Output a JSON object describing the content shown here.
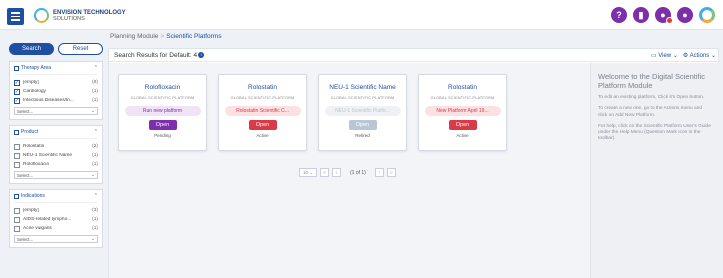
{
  "app": {
    "brand_name": "ENVISION TECHNOLOGY",
    "brand_sub": "SOLUTIONS"
  },
  "top_icons": [
    "help-circle-icon",
    "bookmark-icon",
    "user-alerts-icon",
    "user-profile-icon",
    "envision-logo-icon"
  ],
  "breadcrumb": {
    "root": "Planning Module",
    "separator": ">",
    "current": "Scientific Platforms"
  },
  "sidebar": {
    "search_label": "Search",
    "reset_label": "Reset",
    "facets": [
      {
        "title": "Therapy Area",
        "items": [
          {
            "label": "[empty]",
            "count": "(8)",
            "checked": true
          },
          {
            "label": "Cardiology",
            "count": "(1)",
            "checked": true
          },
          {
            "label": "Infectious Diseases/In...",
            "count": "(1)",
            "checked": true
          }
        ],
        "select_placeholder": "Select..."
      },
      {
        "title": "Product",
        "items": [
          {
            "label": "Rolostatin",
            "count": "(2)",
            "checked": false
          },
          {
            "label": "NEU-1 Scientific Name",
            "count": "(1)",
            "checked": false
          },
          {
            "label": "Rolofloxacin",
            "count": "(1)",
            "checked": false
          }
        ],
        "select_placeholder": "Select..."
      },
      {
        "title": "Indications",
        "items": [
          {
            "label": "[empty]",
            "count": "(3)",
            "checked": false
          },
          {
            "label": "AIDS-related lympho...",
            "count": "(1)",
            "checked": false
          },
          {
            "label": "Acne vulgaris",
            "count": "(1)",
            "checked": false
          }
        ],
        "select_placeholder": "Select..."
      }
    ]
  },
  "results": {
    "title": "Search Results for Default: 4",
    "view_label": "View",
    "actions_label": "Actions"
  },
  "cards": [
    {
      "name": "Rolofloxacin",
      "type": "GLOBAL SCIENTIFIC PLATFORM",
      "pill": "Run new platform",
      "pill_color": "purple",
      "button": "Open",
      "button_disabled": false,
      "status": "Pending"
    },
    {
      "name": "Rolostatin",
      "type": "GLOBAL SCIENTIFIC PLATFORM",
      "pill": "Rolostatin Scientific C...",
      "pill_color": "red",
      "button": "Open",
      "button_disabled": false,
      "status": "Active"
    },
    {
      "name": "NEU-1 Scientific Name",
      "type": "GLOBAL SCIENTIFIC PLATFORM",
      "pill": "NEU-1 Scientific Platfo...",
      "pill_color": "grey",
      "button": "Open",
      "button_disabled": true,
      "status": "Retired"
    },
    {
      "name": "Rolostatin",
      "type": "GLOBAL SCIENTIFIC PLATFORM",
      "pill": "New Platform April 19...",
      "pill_color": "red",
      "button": "Open",
      "button_disabled": false,
      "status": "Active"
    }
  ],
  "pager": {
    "page_size": "10",
    "page_text": "(1 of 1)"
  },
  "help": {
    "title": "Welcome to the Digital Scientific Platform Module",
    "p1": "To edit an existing platform, Click it's Open button.",
    "p2": "To create a new one, go to the Actions menu and click on Add New Platform.",
    "p3": "For help, click on the Scientific Platform User's Guide under the Help Menu (Question Mark Icon in the toolbar)."
  },
  "colors": {
    "primary": "#1e4fa3",
    "purple": "#7c2fa8",
    "red": "#d93a47"
  }
}
